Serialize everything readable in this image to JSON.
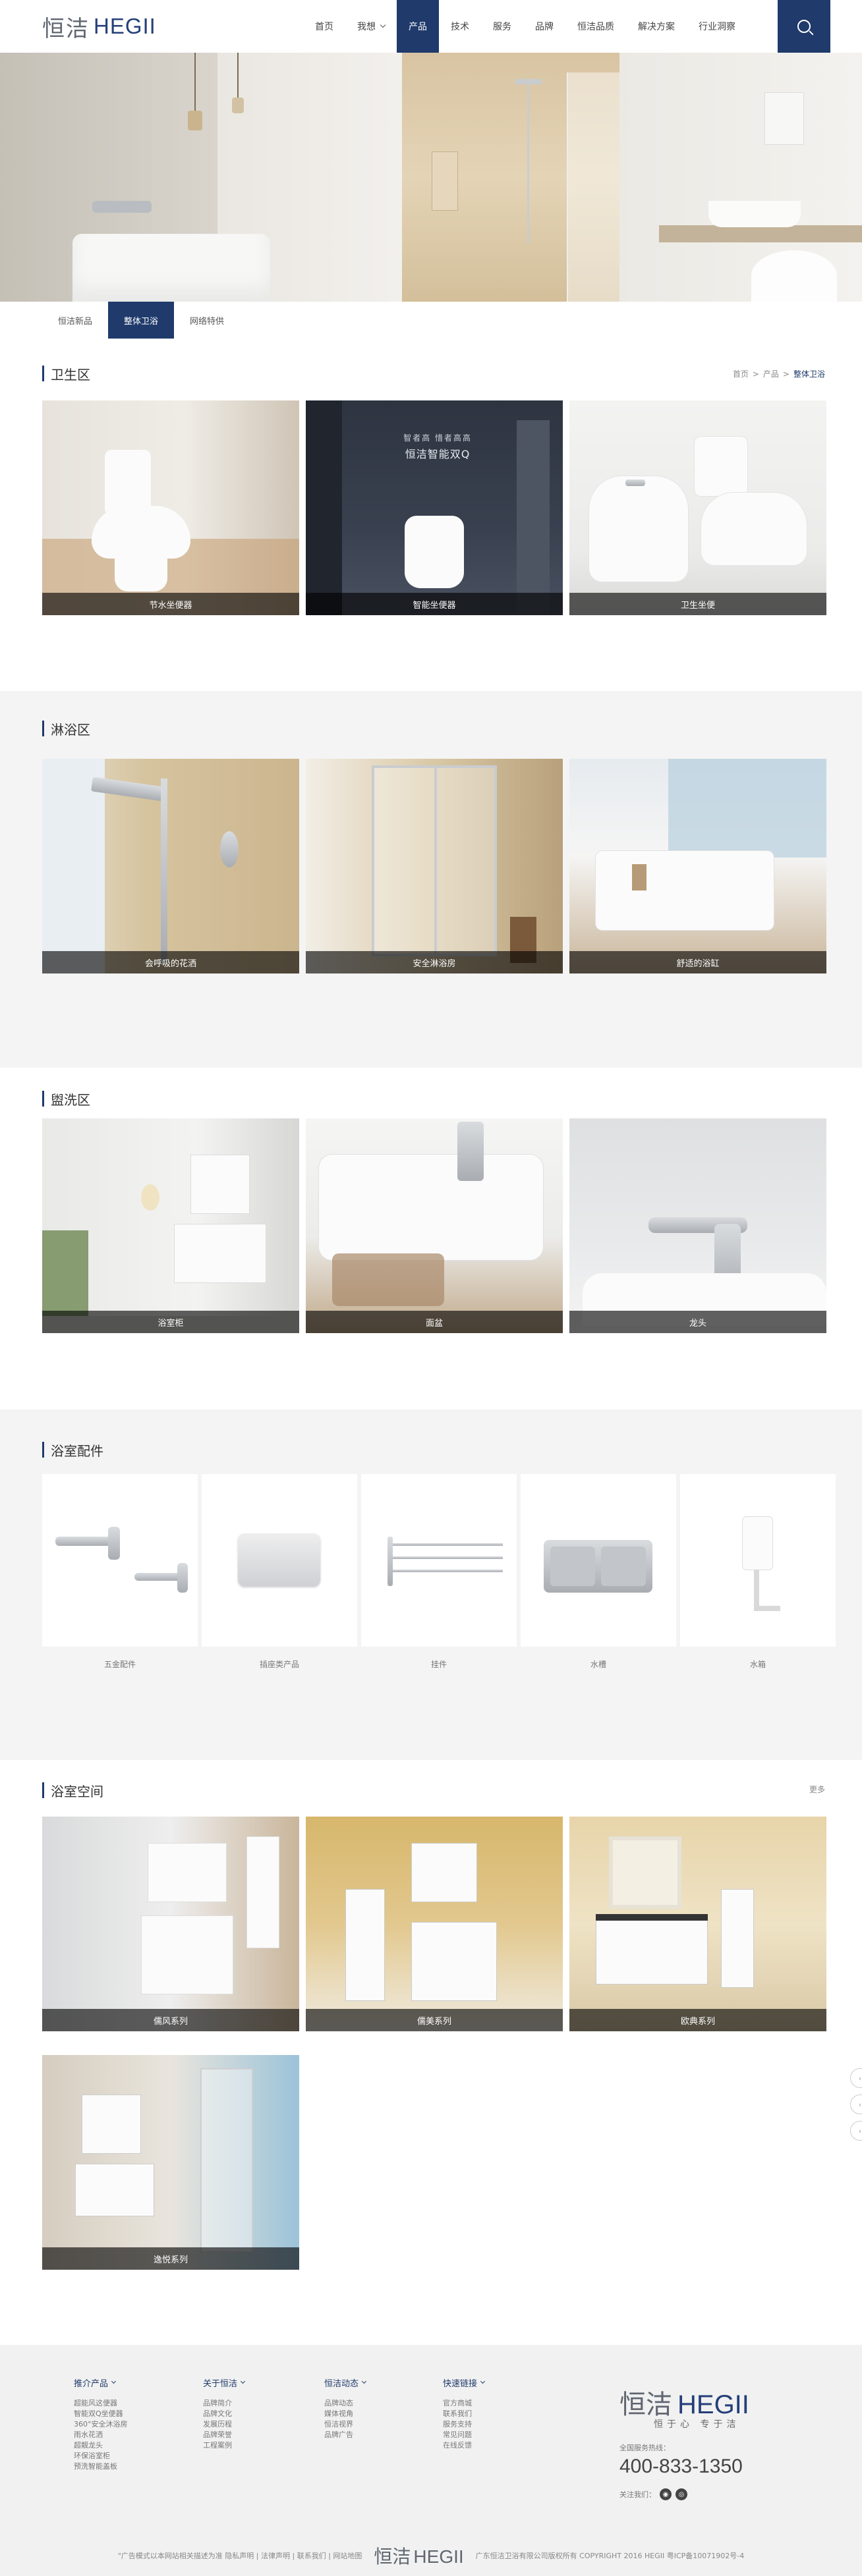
{
  "brand": {
    "cn": "恒洁",
    "en": "HEGII"
  },
  "nav": {
    "items": [
      {
        "label": "首页"
      },
      {
        "label": "我想"
      },
      {
        "label": "产品"
      },
      {
        "label": "技术"
      },
      {
        "label": "服务"
      },
      {
        "label": "品牌"
      },
      {
        "label": "恒洁品质"
      },
      {
        "label": "解决方案"
      },
      {
        "label": "行业洞察"
      }
    ],
    "active_index": 2
  },
  "subtabs": {
    "items": [
      "恒洁新品",
      "整体卫浴",
      "网络特供"
    ],
    "active_index": 1
  },
  "sections": {
    "toilet": {
      "title": "卫生区",
      "breadcrumb": [
        "首页",
        "产品",
        "整体卫浴"
      ],
      "cards": [
        "节水坐便器",
        "智能坐便器",
        "卫生坐便"
      ]
    },
    "shower": {
      "title": "淋浴区",
      "cards": [
        "会呼吸的花洒",
        "安全淋浴房",
        "舒适的浴缸"
      ]
    },
    "wash": {
      "title": "盥洗区",
      "cards": [
        "浴室柜",
        "面盆",
        "龙头"
      ]
    },
    "accessories": {
      "title": "浴室配件",
      "items": [
        "五金配件",
        "插座类产品",
        "挂件",
        "水槽",
        "水箱"
      ]
    },
    "space": {
      "title": "浴室空间",
      "more": "更多",
      "cards": [
        "儒风系列",
        "儒美系列",
        "欧典系列",
        "逸悦系列"
      ]
    }
  },
  "card_overlay": {
    "line1": "智者高 惜者高高",
    "line2": "恒洁智能双Q"
  },
  "footer": {
    "cols": [
      {
        "title": "推介产品",
        "links": [
          "超能风这便器",
          "智能双Q坐便器",
          "360°安全沐浴房",
          "雨水花洒",
          "超靓龙头",
          "环保浴室柜",
          "预洗智能盖板"
        ]
      },
      {
        "title": "关于恒洁",
        "links": [
          "品牌简介",
          "品牌文化",
          "发展历程",
          "品牌荣誉",
          "工程案例"
        ]
      },
      {
        "title": "恒洁动态",
        "links": [
          "品牌动态",
          "媒体视角",
          "恒洁视界",
          "品牌广告"
        ]
      },
      {
        "title": "快速链接",
        "links": [
          "官方商城",
          "联系我们",
          "服务支持",
          "常见问题",
          "在线反馈"
        ]
      }
    ],
    "slogan": "恒于心 专于洁",
    "hotline_label": "全国服务热线：",
    "phone": "400-833-1350",
    "follow_label": "关注我们：",
    "bottom_left": "\"广告模式以本网站相关描述为准  隐私声明  | 法律声明  | 联系我们  | 网站地图",
    "bottom_right": "广东恒洁卫浴有限公司版权所有 COPYRIGHT 2016 HEGII  粤ICP备10071902号-4"
  },
  "colors": {
    "accent": "#1f3a6b",
    "footer_bg": "#f1f1f1",
    "section_gray": "#f4f4f4"
  },
  "icons": [
    "search-icon",
    "chevron-down-icon",
    "wechat-icon",
    "weibo-icon"
  ]
}
